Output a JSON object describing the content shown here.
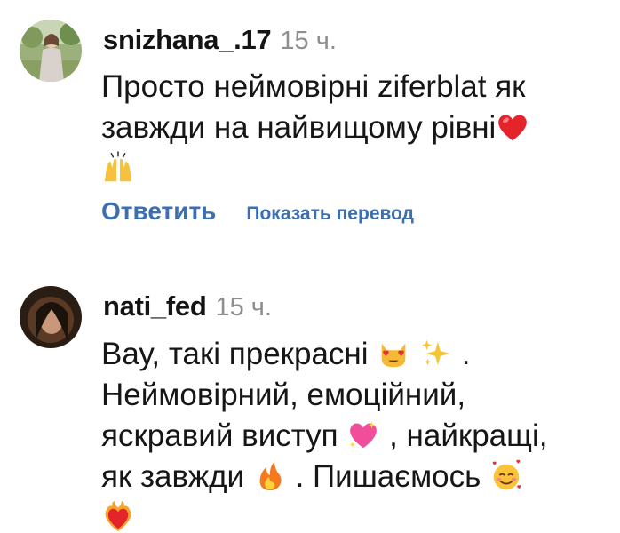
{
  "comments": [
    {
      "username": "snizhana_.17",
      "time": "15 ч.",
      "lines": [
        "Просто неймовірні ziferblat як",
        "завжди на найвищому рівні"
      ],
      "emojis": [
        "red-heart",
        "raising-hands"
      ],
      "reply_label": "Ответить",
      "translate_label": "Показать перевод"
    },
    {
      "username": "nati_fed",
      "time": "15 ч.",
      "lines": [
        "Вау, такі прекрасні",
        "Неймовірний, емоційний,",
        "яскравий виступ",
        ", найкращі,",
        "як завжди",
        ". Пишаємось"
      ],
      "emojis": [
        "heart-eyes-cat",
        "sparkles",
        "sparkling-heart",
        "fire",
        "smiling-face-with-hearts",
        "heart-on-fire"
      ],
      "punctuation": [
        "."
      ]
    }
  ],
  "colors": {
    "link": "#3b6fb0",
    "time": "#8e8e8e",
    "text": "#161616"
  }
}
